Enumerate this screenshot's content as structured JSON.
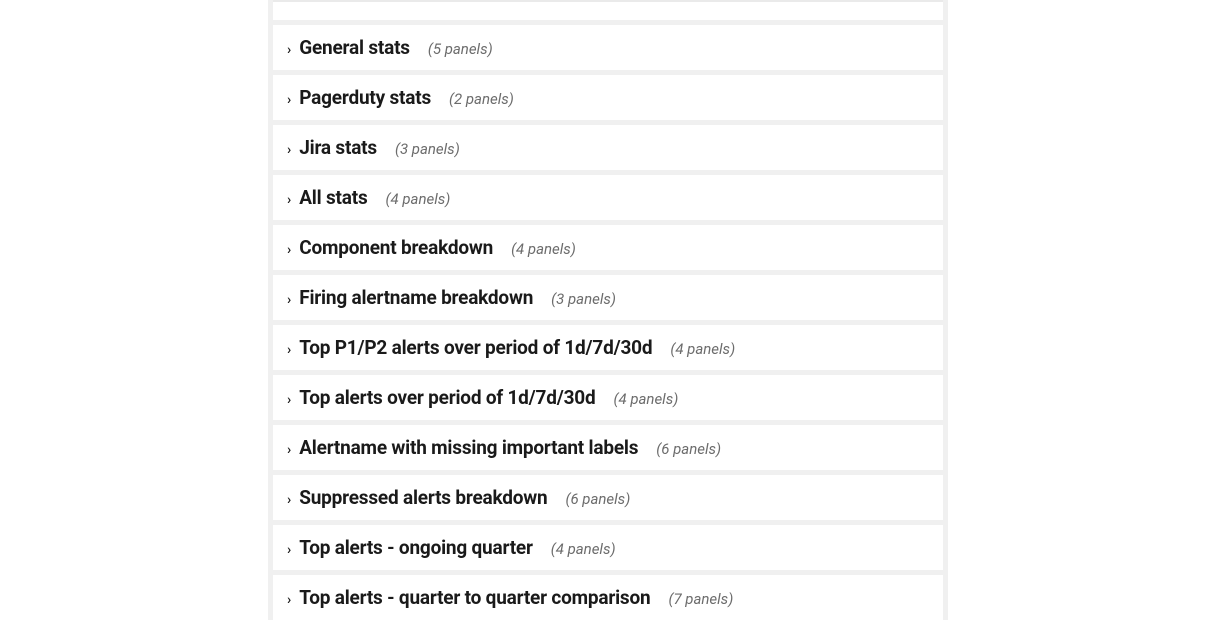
{
  "rows": [
    {
      "title": "General stats",
      "count": "(5 panels)"
    },
    {
      "title": "Pagerduty stats",
      "count": "(2 panels)"
    },
    {
      "title": "Jira stats",
      "count": "(3 panels)"
    },
    {
      "title": "All stats",
      "count": "(4 panels)"
    },
    {
      "title": "Component breakdown",
      "count": "(4 panels)"
    },
    {
      "title": "Firing alertname breakdown",
      "count": "(3 panels)"
    },
    {
      "title": "Top P1/P2 alerts over period of 1d/7d/30d",
      "count": "(4 panels)"
    },
    {
      "title": "Top alerts over period of 1d/7d/30d",
      "count": "(4 panels)"
    },
    {
      "title": "Alertname with missing important labels",
      "count": "(6 panels)"
    },
    {
      "title": "Suppressed alerts breakdown",
      "count": "(6 panels)"
    },
    {
      "title": "Top alerts - ongoing quarter",
      "count": "(4 panels)"
    },
    {
      "title": "Top alerts - quarter to quarter comparison",
      "count": "(7 panels)"
    }
  ],
  "chevron": "›"
}
